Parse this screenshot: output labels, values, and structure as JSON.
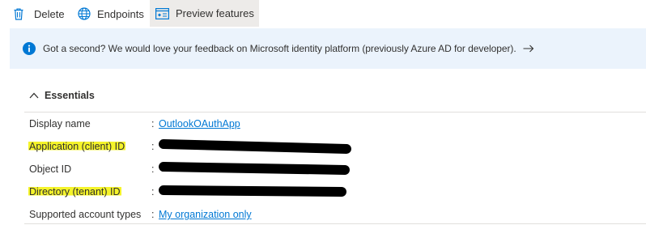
{
  "toolbar": {
    "delete_label": "Delete",
    "delete_icon": "trash-icon",
    "endpoints_label": "Endpoints",
    "endpoints_icon": "globe-icon",
    "preview_label": "Preview features",
    "preview_icon": "preview-window-icon"
  },
  "banner": {
    "icon": "info-icon",
    "text": "Got a second? We would love your feedback on Microsoft identity platform (previously Azure AD for developer).",
    "arrow_icon": "arrow-right-icon",
    "background": "#ebf3fc",
    "icon_color": "#0078d4"
  },
  "essentials": {
    "title": "Essentials",
    "chevron_icon": "chevron-up-icon",
    "colon": ":",
    "rows": [
      {
        "label": "Display name",
        "value": "OutlookOAuthApp",
        "is_link": true,
        "redacted": false,
        "highlighted": false
      },
      {
        "label": "Application (client) ID",
        "value": "",
        "is_link": false,
        "redacted": true,
        "highlighted": true
      },
      {
        "label": "Object ID",
        "value": "",
        "is_link": false,
        "redacted": true,
        "highlighted": false
      },
      {
        "label": "Directory (tenant) ID",
        "value": "",
        "is_link": false,
        "redacted": true,
        "highlighted": true
      },
      {
        "label": "Supported account types",
        "value": "My organization only",
        "is_link": true,
        "redacted": false,
        "highlighted": false
      }
    ]
  },
  "colors": {
    "link": "#0078d4",
    "highlight": "#f5f42a",
    "selected_tab_bg": "#edebe9",
    "text": "#323130"
  }
}
